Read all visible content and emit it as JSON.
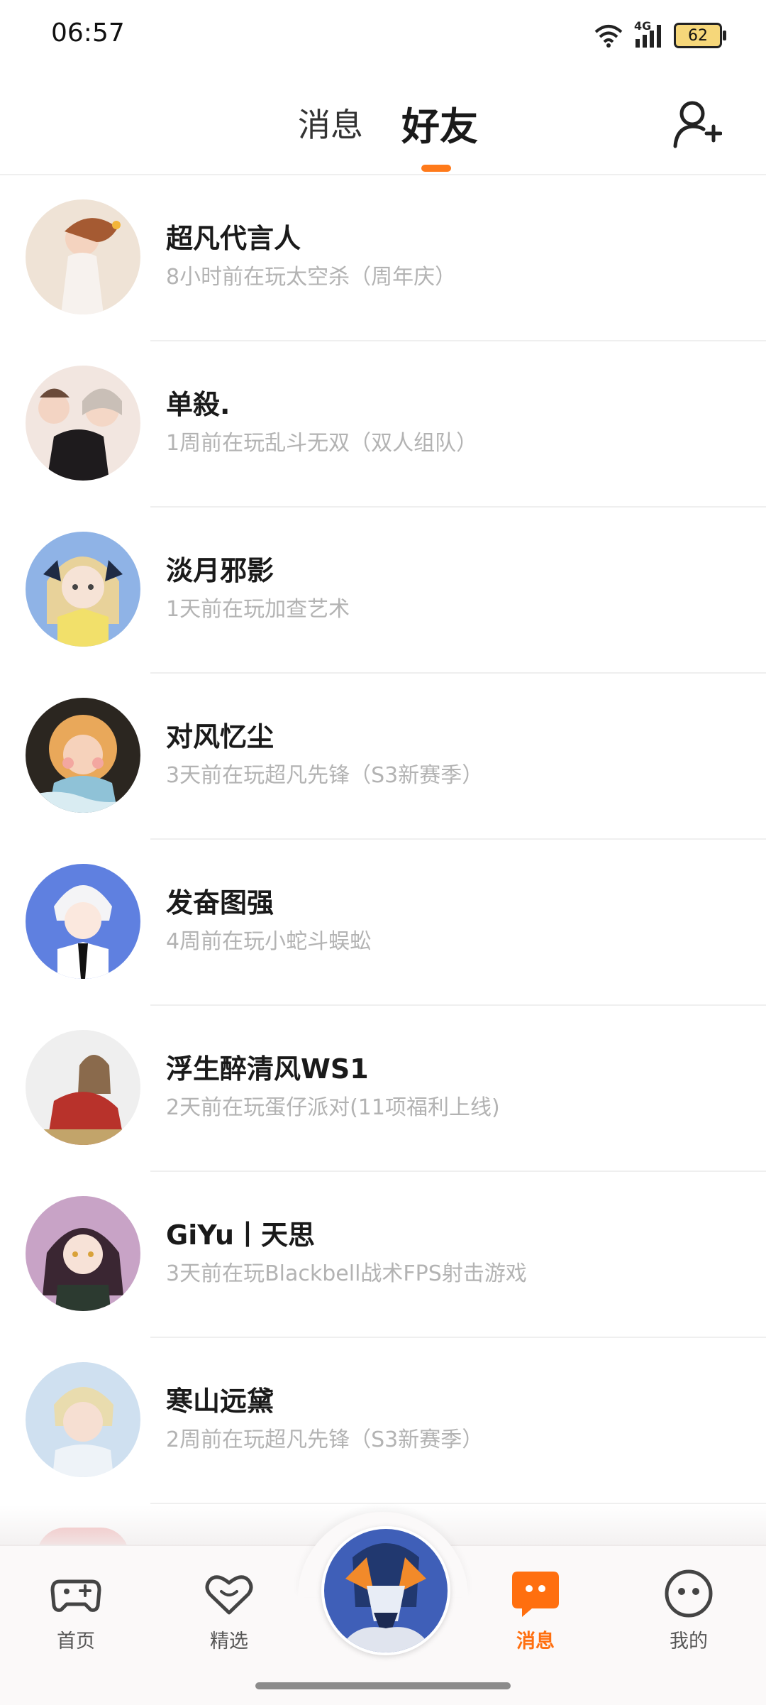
{
  "status_bar": {
    "time": "06:57",
    "network": "4G",
    "battery": "62"
  },
  "header": {
    "tabs": [
      {
        "label": "消息",
        "active": false
      },
      {
        "label": "好友",
        "active": true
      }
    ],
    "accent_color": "#ff7a1a",
    "add_friend_icon": "add-user-icon"
  },
  "friends": [
    {
      "name": "超凡代言人",
      "status": "8小时前在玩太空杀（周年庆）"
    },
    {
      "name": "单殺.",
      "status": "1周前在玩乱斗无双（双人组队）"
    },
    {
      "name": "淡月邪影",
      "status": "1天前在玩加查艺术"
    },
    {
      "name": "对风忆尘",
      "status": "3天前在玩超凡先锋（S3新赛季）"
    },
    {
      "name": "发奋图强",
      "status": "4周前在玩小蛇斗蜈蚣"
    },
    {
      "name": "浮生醉清风WS1",
      "status": "2天前在玩蛋仔派对(11项福利上线)"
    },
    {
      "name": "GiYu丨天思",
      "status": "3天前在玩Blackbell战术FPS射击游戏"
    },
    {
      "name": "寒山远黛",
      "status": "2周前在玩超凡先锋（S3新赛季）"
    }
  ],
  "bottom_nav": {
    "items": [
      {
        "label": "首页",
        "icon": "gamepad-icon",
        "active": false
      },
      {
        "label": "精选",
        "icon": "heart-chat-icon",
        "active": false
      },
      {
        "label": "消息",
        "icon": "message-bubble-icon",
        "active": true
      },
      {
        "label": "我的",
        "icon": "face-icon",
        "active": false
      }
    ],
    "active_color": "#ff6f0f"
  }
}
